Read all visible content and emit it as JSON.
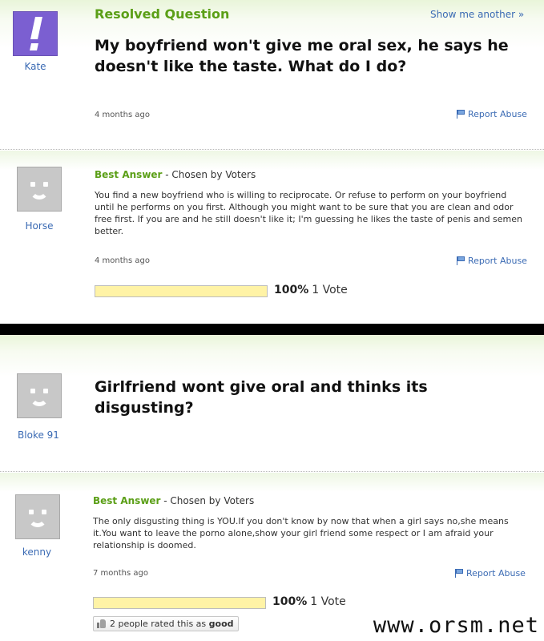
{
  "panel1": {
    "asker": "Kate",
    "resolved_label": "Resolved Question",
    "show_another": "Show me another »",
    "question": "My boyfriend won't give me oral sex, he says he doesn't like the taste. What do I do?",
    "question_time": "4 months ago",
    "report_abuse": "Report Abuse",
    "answerer": "Horse",
    "best_answer_label": "Best Answer",
    "chosen_by": " - Chosen by Voters",
    "answer": "You find a new boyfriend who is willing to reciprocate. Or refuse to perform on your boyfriend until he performs on you first. Although you might want to be sure that you are clean and odor free first. If you are and he still doesn't like it; I'm guessing he likes the taste of penis and semen better.",
    "answer_time": "4 months ago",
    "answer_report_abuse": "Report Abuse",
    "vote_percent": "100%",
    "vote_percent_value": 100,
    "vote_count": "1 Vote"
  },
  "panel2": {
    "asker": "Bloke 91",
    "question": "Girlfriend wont give oral and thinks its disgusting?",
    "answerer": "kenny",
    "best_answer_label": "Best Answer",
    "chosen_by": " - Chosen by Voters",
    "answer": "The only disgusting thing is YOU.If you don't know by now that when a girl says no,she means it.You want to leave the porno alone,show your girl friend some respect or I am afraid your relationship is doomed.",
    "answer_time": "7 months ago",
    "answer_report_abuse": "Report Abuse",
    "vote_percent": "100%",
    "vote_percent_value": 100,
    "vote_count": "1 Vote",
    "rated_prefix": "2 people rated this as",
    "rated_word": "good"
  },
  "watermark": "www.orsm.net",
  "icons": {
    "flag": "flag-icon",
    "thumb": "thumbs-up-icon",
    "avatar_default": "smiley-avatar",
    "avatar_yahoo": "yahoo-exclamation-avatar"
  },
  "colors": {
    "green": "#5b9f17",
    "link_blue": "#3b6bb4",
    "vote_yellow": "#fff3a6"
  }
}
